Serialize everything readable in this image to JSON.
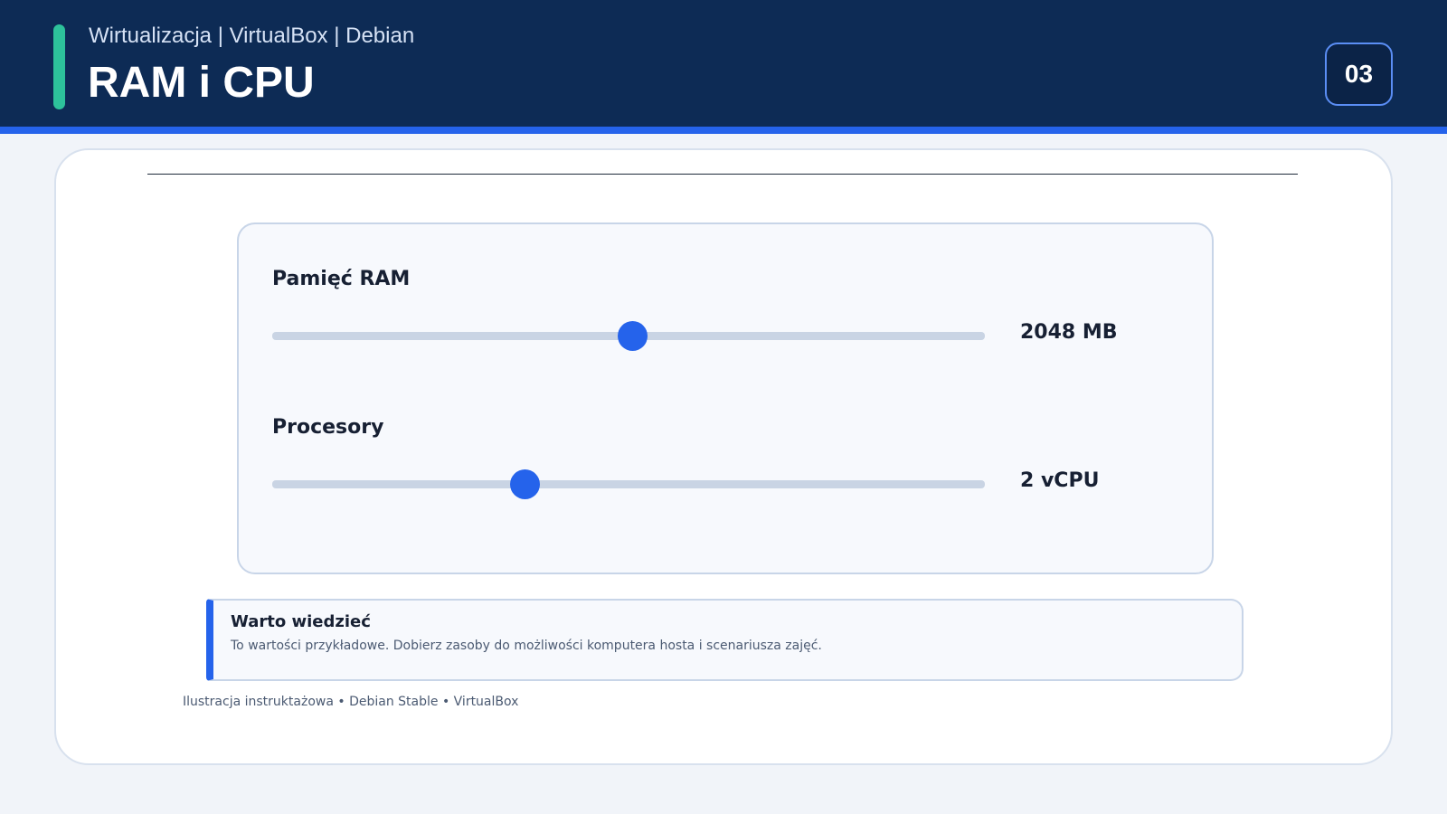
{
  "header": {
    "subtitle": "Wirtualizacja | VirtualBox | Debian",
    "title": "RAM i CPU",
    "slide_number": "03"
  },
  "settings": {
    "ram": {
      "label": "Pamięć RAM",
      "value": "2048 MB",
      "slider_level": 0.505
    },
    "cpu": {
      "label": "Procesory",
      "value": "2 vCPU",
      "slider_level": 0.354
    }
  },
  "info": {
    "title": "Warto wiedzieć",
    "text": "To wartości przykładowe. Dobierz zasoby do możliwości komputera hosta i scenariusza zajęć."
  },
  "footer": {
    "note": "Ilustracja instruktażowa • Debian Stable • VirtualBox"
  },
  "colors": {
    "header_bg": "#0d2b55",
    "accent_blue": "#2563eb",
    "accent_green": "#2dc29b"
  }
}
